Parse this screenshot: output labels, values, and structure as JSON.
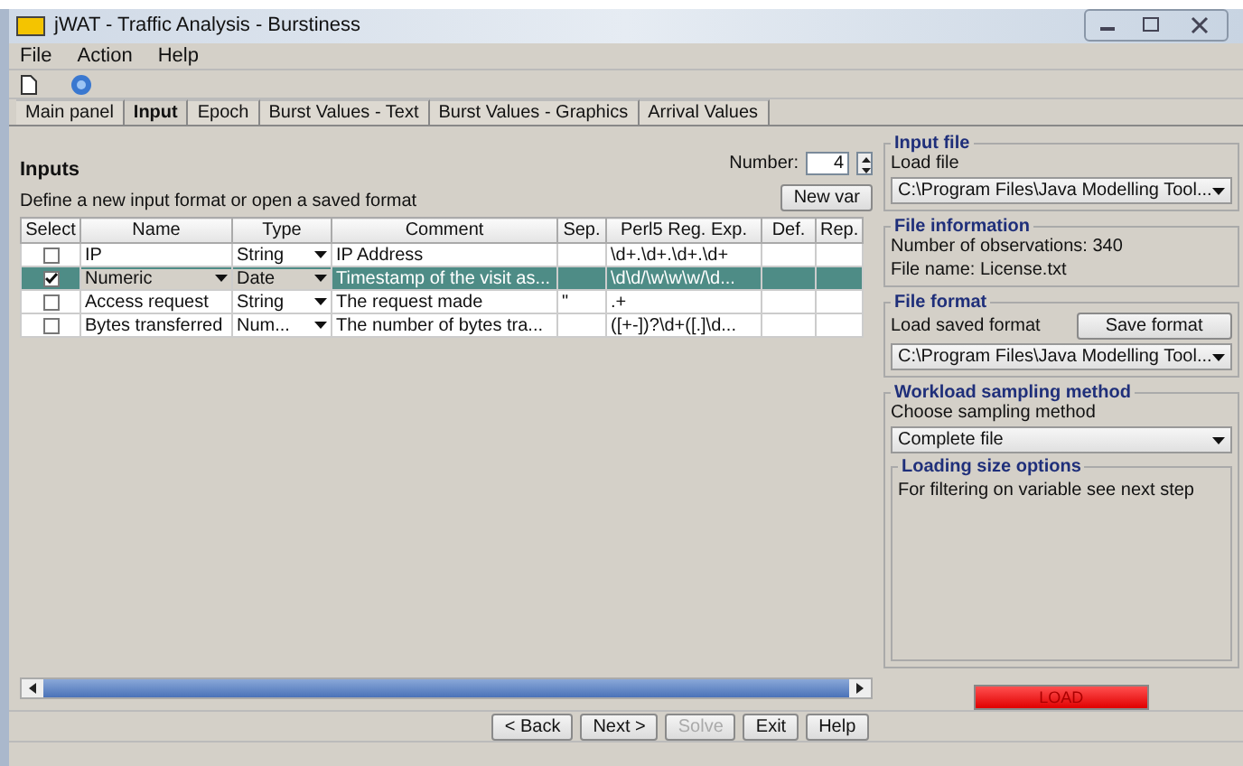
{
  "window": {
    "title": "jWAT - Traffic Analysis  - Burstiness"
  },
  "menu": [
    "File",
    "Action",
    "Help"
  ],
  "tabs": [
    {
      "label": "Main panel",
      "selected": false
    },
    {
      "label": "Input",
      "selected": true
    },
    {
      "label": "Epoch",
      "selected": false
    },
    {
      "label": "Burst Values - Text",
      "selected": false
    },
    {
      "label": "Burst Values - Graphics",
      "selected": false
    },
    {
      "label": "Arrival Values",
      "selected": false
    }
  ],
  "inputs": {
    "title": "Inputs",
    "subtitle": "Define a new input format or open a saved format",
    "number_label": "Number:",
    "number": "4",
    "new_var": "New var",
    "table": {
      "columns": [
        "Select",
        "Name",
        "Type",
        "Comment",
        "Sep.",
        "Perl5 Reg. Exp.",
        "Def.",
        "Rep."
      ],
      "rows": [
        {
          "selected": false,
          "name": "IP",
          "name_dropdown": false,
          "type": "String",
          "comment": "IP Address",
          "sep": "",
          "regex": "\\d+.\\d+.\\d+.\\d+"
        },
        {
          "selected": true,
          "name": "Numeric",
          "name_dropdown": true,
          "type": "Date",
          "comment": "Timestamp of the visit as...",
          "sep": "",
          "regex": "\\d\\d/\\w\\w\\w/\\d..."
        },
        {
          "selected": false,
          "name": "Access request",
          "name_dropdown": false,
          "type": "String",
          "comment": "The request made",
          "sep": "\"",
          "regex": ".+"
        },
        {
          "selected": false,
          "name": "Bytes transferred",
          "name_dropdown": false,
          "type": "Num...",
          "comment": "The number of bytes tra...",
          "sep": "",
          "regex": "([+-])?\\d+([.]\\d..."
        }
      ]
    }
  },
  "input_file": {
    "title": "Input file",
    "label": "Load file",
    "path": "C:\\Program Files\\Java Modelling Tool..."
  },
  "file_information": {
    "title": "File information",
    "lines": [
      "Number of observations: 340",
      "File name: License.txt"
    ]
  },
  "file_format": {
    "title": "File format",
    "label": "Load saved format",
    "button": "Save format",
    "path": "C:\\Program Files\\Java Modelling Tool..."
  },
  "workload": {
    "title": "Workload sampling method",
    "label": "Choose sampling method",
    "value": "Complete file",
    "options_title": "Loading size options",
    "note": "For filtering on variable see next step"
  },
  "load_button": "LOAD",
  "buttons": [
    {
      "label": "< Back",
      "disabled": false
    },
    {
      "label": "Next >",
      "disabled": false
    },
    {
      "label": "Solve",
      "disabled": true
    },
    {
      "label": "Exit",
      "disabled": false
    },
    {
      "label": "Help",
      "disabled": false
    }
  ]
}
